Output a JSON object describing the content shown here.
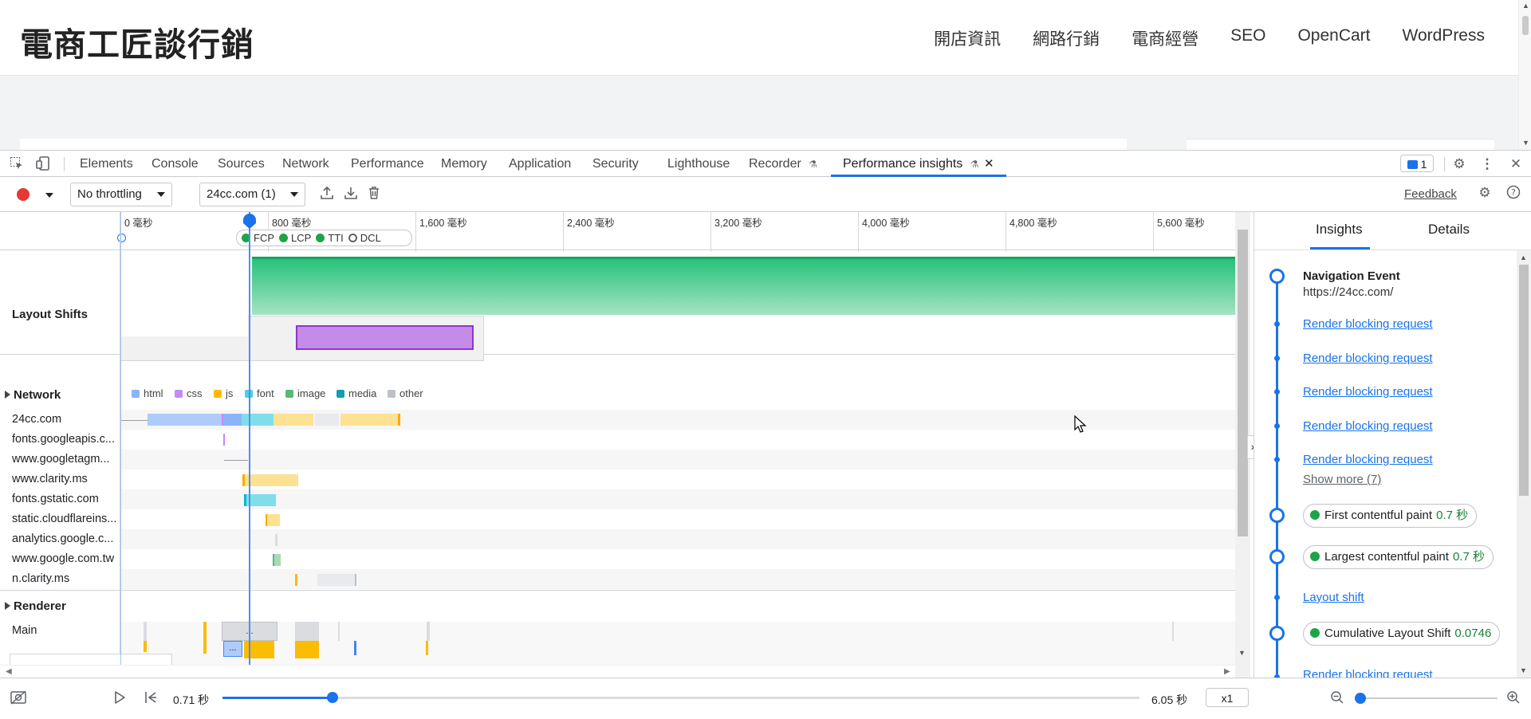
{
  "site": {
    "logo": "電商工匠談行銷",
    "nav": [
      "開店資訊",
      "網路行銷",
      "電商經營",
      "SEO",
      "OpenCart",
      "WordPress"
    ]
  },
  "devtools": {
    "tabs": [
      "Elements",
      "Console",
      "Sources",
      "Network",
      "Performance",
      "Memory",
      "Application",
      "Security",
      "Lighthouse",
      "Recorder",
      "Performance insights"
    ],
    "active_tab": "Performance insights",
    "issues_count": "1"
  },
  "toolbar": {
    "throttling": "No throttling",
    "recording": "24cc.com (1)",
    "feedback": "Feedback"
  },
  "timeline": {
    "ticks": [
      "0 毫秒",
      "800 毫秒",
      "1,600 毫秒",
      "2,400 毫秒",
      "3,200 毫秒",
      "4,000 毫秒",
      "4,800 毫秒",
      "5,600 毫秒"
    ],
    "markers": [
      "FCP",
      "LCP",
      "TTI",
      "DCL"
    ],
    "sections": {
      "layout_shifts": "Layout Shifts",
      "network": "Network",
      "renderer": "Renderer",
      "main": "Main"
    },
    "legend": [
      {
        "label": "html",
        "color": "#8ab4f8"
      },
      {
        "label": "css",
        "color": "#c58af9"
      },
      {
        "label": "js",
        "color": "#fbbc04"
      },
      {
        "label": "font",
        "color": "#4ecde6"
      },
      {
        "label": "image",
        "color": "#5bb974"
      },
      {
        "label": "media",
        "color": "#129eaf"
      },
      {
        "label": "other",
        "color": "#bdc1c6"
      }
    ],
    "hosts": [
      "24cc.com",
      "fonts.googleapis.c...",
      "www.googletagm...",
      "www.clarity.ms",
      "fonts.gstatic.com",
      "static.cloudflareins...",
      "analytics.google.c...",
      "www.google.com.tw",
      "n.clarity.ms"
    ],
    "ellipsis": "..."
  },
  "sidebar": {
    "tabs": [
      "Insights",
      "Details"
    ],
    "nav_title": "Navigation Event",
    "nav_url": "https://24cc.com/",
    "rbr": "Render blocking request",
    "show_more": "Show more (7)",
    "fcp_label": "First contentful paint",
    "fcp_value": "0.7 秒",
    "lcp_label": "Largest contentful paint",
    "lcp_value": "0.7 秒",
    "layout_shift": "Layout shift",
    "cls_label": "Cumulative Layout Shift",
    "cls_value": "0.0746"
  },
  "playback": {
    "current": "0.71 秒",
    "total": "6.05 秒",
    "speed": "x1",
    "progress": 0.12,
    "zoom": 0.02
  }
}
